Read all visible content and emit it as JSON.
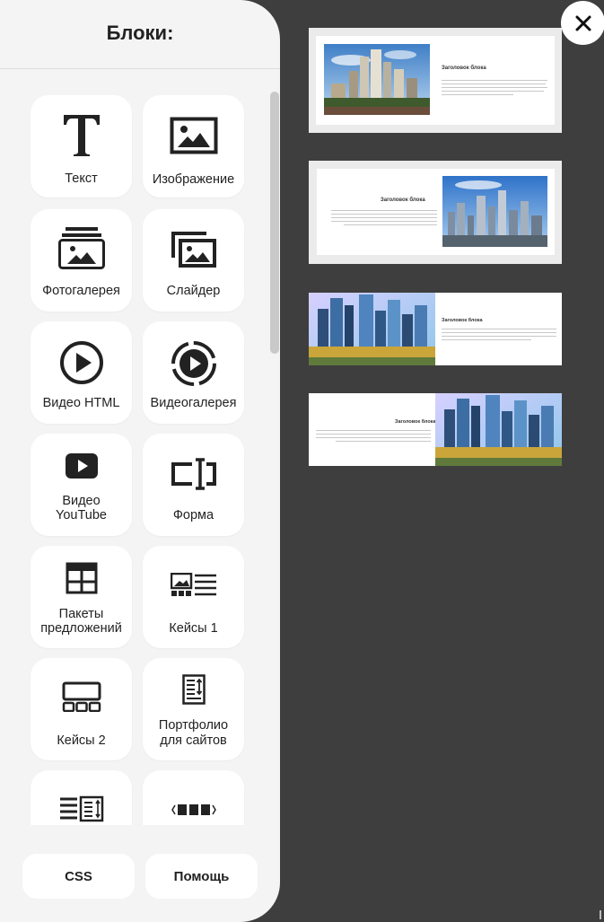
{
  "panel": {
    "title": "Блоки:",
    "blocks": [
      {
        "label": "Текст",
        "icon": "text-icon"
      },
      {
        "label": "Изображение",
        "icon": "image-icon"
      },
      {
        "label": "Фотогалерея",
        "icon": "photo-gallery-icon"
      },
      {
        "label": "Слайдер",
        "icon": "slider-icon"
      },
      {
        "label": "Видео HTML",
        "icon": "play-circle-icon"
      },
      {
        "label": "Видеогалерея",
        "icon": "video-gallery-icon"
      },
      {
        "label_line1": "Видео",
        "label_line2": "YouTube",
        "icon": "youtube-icon"
      },
      {
        "label": "Форма",
        "icon": "form-icon"
      },
      {
        "label_line1": "Пакеты",
        "label_line2": "предложений",
        "icon": "table-icon"
      },
      {
        "label": "Кейсы 1",
        "icon": "cases1-icon"
      },
      {
        "label": "Кейсы 2",
        "icon": "cases2-icon"
      },
      {
        "label_line1": "Портфолио",
        "label_line2": "для сайтов",
        "icon": "portfolio-icon"
      },
      {
        "label": "",
        "icon": "text-list-icon"
      },
      {
        "label": "",
        "icon": "carousel-icon"
      }
    ],
    "css_button": "CSS",
    "help_button": "Помощь"
  },
  "previews": [
    {
      "heading": "Заголовок блока",
      "layout": "image-left"
    },
    {
      "heading": "Заголовок блока",
      "layout": "image-right"
    },
    {
      "heading": "Заголовок блока",
      "layout": "full-image-left"
    },
    {
      "heading": "Заголовок блока",
      "layout": "full-image-right"
    }
  ],
  "colors": {
    "background": "#3e3e3e",
    "panel": "#f4f4f4",
    "tile": "#ffffff",
    "icon": "#222222"
  }
}
